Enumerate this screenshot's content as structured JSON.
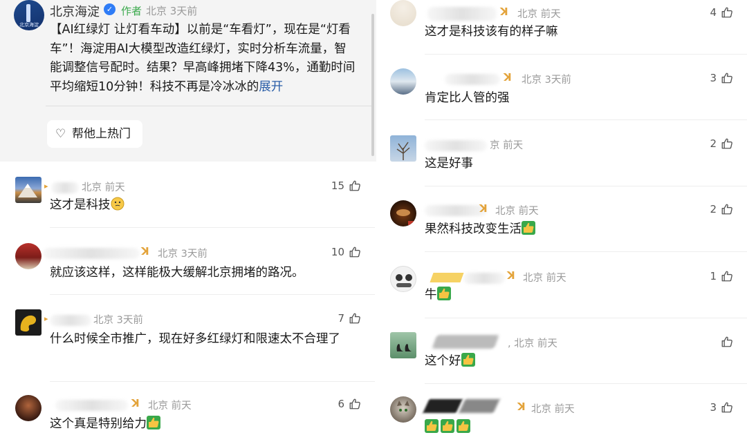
{
  "post": {
    "author_name": "北京海淀",
    "author_tag": "作者",
    "location_time": "北京 3天前",
    "body": "【AI红绿灯 让灯看车动】以前是“车看灯”，现在是“灯看车”！海淀用AI大模型改造红绿灯，实时分析车流量，智能调整信号配时。结果？早高峰拥堵下降43%，通勤时间平均缩短10分钟！科技不再是冷冰冰的",
    "expand_label": "展开",
    "boost_label": "帮他上热门",
    "avatar_mark": "北京海淀"
  },
  "comments_left": [
    {
      "meta": "北京 前天",
      "likes": "15",
      "text": "这才是科技"
    },
    {
      "meta": "北京 3天前",
      "likes": "10",
      "text": "就应该这样，这样能极大缓解北京拥堵的路况。"
    },
    {
      "meta": "北京 3天前",
      "likes": "7",
      "text": "什么时候全市推广，现在好多红绿灯和限速太不合理了"
    },
    {
      "meta": "北京 前天",
      "likes": "6",
      "text": "这个真是特别给力"
    }
  ],
  "comments_right": [
    {
      "meta": "北京 前天",
      "likes": "4",
      "text": "这才是科技该有的样子嘛"
    },
    {
      "meta": "北京 3天前",
      "likes": "3",
      "text": "肯定比人管的强"
    },
    {
      "meta": "京 前天",
      "likes": "2",
      "text": "这是好事"
    },
    {
      "meta": "北京 前天",
      "likes": "2",
      "text": "果然科技改变生活"
    },
    {
      "meta": "北京 前天",
      "likes": "1",
      "text": "牛"
    },
    {
      "meta": ", 北京 前天",
      "likes": "",
      "text": "这个好"
    },
    {
      "meta": "北京 前天",
      "likes": "3",
      "text": ""
    }
  ],
  "colors": {
    "accent_blue": "#2a5ea8",
    "author_green": "#3aa94c",
    "verified_blue": "#2f7cf6",
    "badge_gold": "#e3a33a",
    "meta_gray": "#9a9a9a"
  },
  "icons": {
    "like": "thumbs-up-outline-icon",
    "verified": "verified-check-icon",
    "heart": "heart-outline-icon",
    "thumbs_emoji": "thumbs-up-emoji-icon",
    "thinking_emoji": "thinking-face-emoji-icon",
    "badge": "fan-badge-icon"
  }
}
